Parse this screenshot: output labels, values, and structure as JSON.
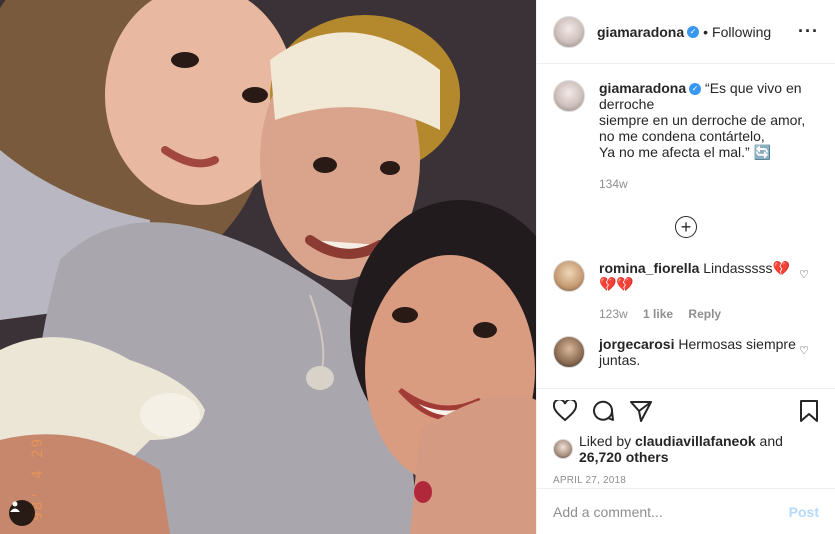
{
  "post": {
    "author": "giamaradona",
    "follow_status": "Following",
    "more_icon": "more-horizontal-icon"
  },
  "photo": {
    "date_stamp": "98' 4 29",
    "user_tag_icon": "user-icon"
  },
  "caption": {
    "username": "giamaradona",
    "text": "“Es que vivo en derroche\nsiempre en un derroche de amor,\nno me condena contártelo,\nYa no me afecta el mal.” 🔄",
    "time": "134w"
  },
  "load_more_icon": "plus-circle-icon",
  "comments": [
    {
      "username": "romina_fiorella",
      "text": "Lindasssss💔💔💔",
      "time": "123w",
      "likes": "1 like",
      "reply": "Reply"
    },
    {
      "username": "jorgecarosi",
      "text": "Hermosas siempre juntas.",
      "time": "",
      "likes": "",
      "reply": ""
    }
  ],
  "actions": {
    "like_icon": "heart-icon",
    "comment_icon": "comment-icon",
    "share_icon": "share-icon",
    "save_icon": "bookmark-icon"
  },
  "likes": {
    "prefix": "Liked by",
    "user": "claudiavillafaneok",
    "joiner": "and",
    "others": "26,720 others"
  },
  "date": "APRIL 27, 2018",
  "add_comment": {
    "placeholder": "Add a comment...",
    "post_label": "Post"
  },
  "colors": {
    "verified": "#3897f0",
    "post_disabled": "#b3dbff",
    "muted": "#8e8e8e"
  }
}
